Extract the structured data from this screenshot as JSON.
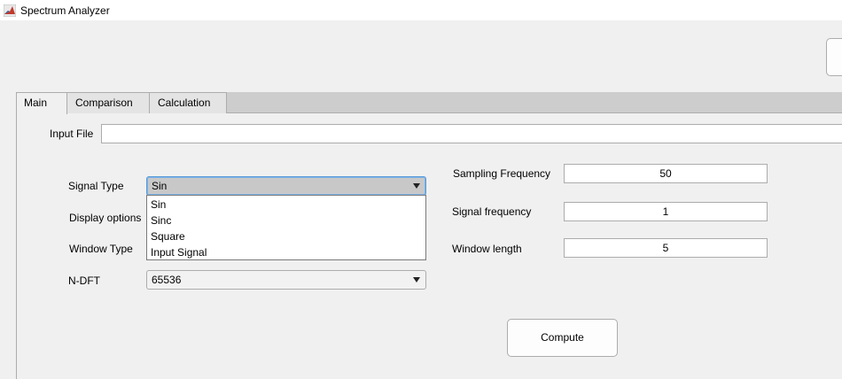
{
  "window": {
    "title": "Spectrum Analyzer",
    "icon": "matlab-icon"
  },
  "tabs": [
    {
      "label": "Main",
      "active": true
    },
    {
      "label": "Comparison",
      "active": false
    },
    {
      "label": "Calculation",
      "active": false
    }
  ],
  "main": {
    "input_file": {
      "label": "Input File",
      "value": ""
    },
    "signal_type": {
      "label": "Signal Type",
      "selected": "Sin",
      "expanded": true,
      "options": [
        "Sin",
        "Sinc",
        "Square",
        "Input Signal"
      ]
    },
    "display_options": {
      "label": "Display options"
    },
    "window_type": {
      "label": "Window Type"
    },
    "ndft": {
      "label": "N-DFT",
      "selected": "65536"
    },
    "sampling_frequency": {
      "label": "Sampling Frequency",
      "value": "50"
    },
    "signal_frequency": {
      "label": "Signal frequency",
      "value": "1"
    },
    "window_length": {
      "label": "Window length",
      "value": "5"
    },
    "compute_label": "Compute"
  },
  "colors": {
    "background": "#f0f0f0",
    "tab_strip": "#cdcdcd",
    "focus_border": "#5b9bd5",
    "popup_selected_bg": "#c8c8c8"
  }
}
